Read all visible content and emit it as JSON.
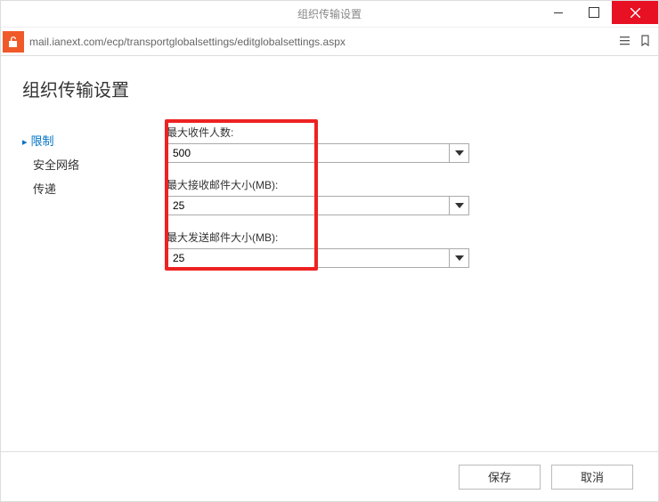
{
  "window": {
    "title": "组织传输设置"
  },
  "addressbar": {
    "url": "mail.ianext.com/ecp/transportglobalsettings/editglobalsettings.aspx"
  },
  "page": {
    "heading": "组织传输设置"
  },
  "sidebar": {
    "items": [
      {
        "label": "限制",
        "active": true
      },
      {
        "label": "安全网络",
        "active": false
      },
      {
        "label": "传递",
        "active": false
      }
    ]
  },
  "form": {
    "fields": [
      {
        "label": "最大收件人数:",
        "value": "500"
      },
      {
        "label": "最大接收邮件大小(MB):",
        "value": "25"
      },
      {
        "label": "最大发送邮件大小(MB):",
        "value": "25"
      }
    ]
  },
  "footer": {
    "save": "保存",
    "cancel": "取消"
  }
}
